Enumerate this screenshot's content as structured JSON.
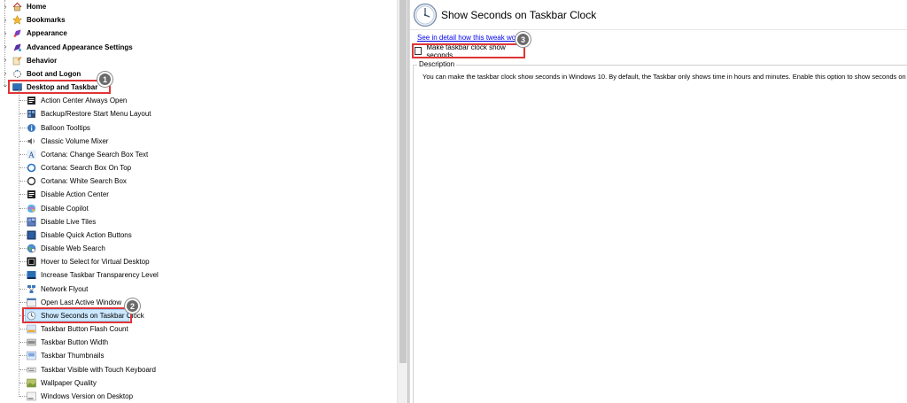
{
  "categories": [
    {
      "label": "Home",
      "icon": "home-icon",
      "expanded": false
    },
    {
      "label": "Bookmarks",
      "icon": "star-icon",
      "expanded": false
    },
    {
      "label": "Appearance",
      "icon": "paint-icon",
      "expanded": false
    },
    {
      "label": "Advanced Appearance Settings",
      "icon": "paint-advanced-icon",
      "expanded": false
    },
    {
      "label": "Behavior",
      "icon": "behavior-icon",
      "expanded": false
    },
    {
      "label": "Boot and Logon",
      "icon": "boot-icon",
      "expanded": false
    },
    {
      "label": "Desktop and Taskbar",
      "icon": "desktop-icon",
      "expanded": true
    }
  ],
  "items": [
    {
      "label": "Action Center Always Open",
      "icon": "action-center-icon"
    },
    {
      "label": "Backup/Restore Start Menu Layout",
      "icon": "start-menu-icon"
    },
    {
      "label": "Balloon Tooltips",
      "icon": "info-icon"
    },
    {
      "label": "Classic Volume Mixer",
      "icon": "speaker-icon"
    },
    {
      "label": "Cortana: Change Search Box Text",
      "icon": "text-a-icon"
    },
    {
      "label": "Cortana: Search Box On Top",
      "icon": "cortana-ring-icon"
    },
    {
      "label": "Cortana: White Search Box",
      "icon": "cortana-white-icon"
    },
    {
      "label": "Disable Action Center",
      "icon": "action-center-icon"
    },
    {
      "label": "Disable Copilot",
      "icon": "copilot-icon"
    },
    {
      "label": "Disable Live Tiles",
      "icon": "tiles-icon"
    },
    {
      "label": "Disable Quick Action Buttons",
      "icon": "quick-action-icon"
    },
    {
      "label": "Disable Web Search",
      "icon": "globe-icon"
    },
    {
      "label": "Hover to Select for Virtual Desktop",
      "icon": "virtual-desktop-icon"
    },
    {
      "label": "Increase Taskbar Transparency Level",
      "icon": "taskbar-icon"
    },
    {
      "label": "Network Flyout",
      "icon": "network-icon"
    },
    {
      "label": "Open Last Active Window",
      "icon": "window-icon"
    },
    {
      "label": "Show Seconds on Taskbar Clock",
      "icon": "clock-icon",
      "selected": true
    },
    {
      "label": "Taskbar Button Flash Count",
      "icon": "taskbar-flash-icon"
    },
    {
      "label": "Taskbar Button Width",
      "icon": "taskbar-width-icon"
    },
    {
      "label": "Taskbar Thumbnails",
      "icon": "thumbnails-icon"
    },
    {
      "label": "Taskbar Visible with Touch Keyboard",
      "icon": "keyboard-icon"
    },
    {
      "label": "Wallpaper Quality",
      "icon": "wallpaper-icon"
    },
    {
      "label": "Windows Version on Desktop",
      "icon": "windows-version-icon"
    }
  ],
  "detail": {
    "title": "Show Seconds on Taskbar Clock",
    "link": "See in detail how this tweak works",
    "option": "Make taskbar clock show seconds",
    "option_checked": false,
    "description_label": "Description",
    "description": "You can make the taskbar clock show seconds in Windows 10. By default, the Taskbar only shows time in hours and minutes. Enable this option to show seconds on the taskbar clock."
  },
  "annotations": {
    "badge1": "1",
    "badge2": "2",
    "badge3": "3"
  },
  "colors": {
    "highlight": "#e03535",
    "selection": "#cce8ff",
    "link": "#0000ee"
  }
}
